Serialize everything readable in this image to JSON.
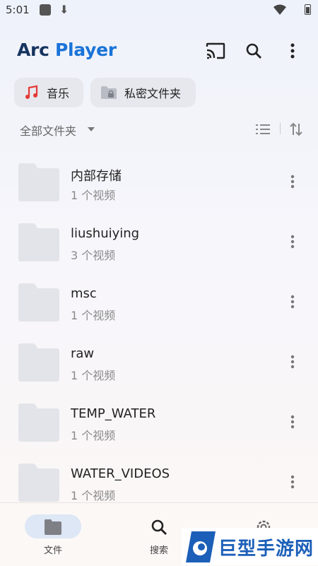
{
  "status_bar": {
    "time": "5:01"
  },
  "header": {
    "logo_part1": "Arc",
    "logo_part2": " Player"
  },
  "chips": {
    "music": "音乐",
    "private": "私密文件夹"
  },
  "filter": {
    "label": "全部文件夹"
  },
  "folders": [
    {
      "name": "内部存储",
      "count": "1 个视频"
    },
    {
      "name": "liushuiying",
      "count": "3 个视频"
    },
    {
      "name": "msc",
      "count": "1 个视频"
    },
    {
      "name": "raw",
      "count": "1 个视频"
    },
    {
      "name": "TEMP_WATER",
      "count": "1 个视频"
    },
    {
      "name": "WATER_VIDEOS",
      "count": "1 个视频"
    }
  ],
  "bottom_nav": {
    "files": "文件",
    "search": "搜索"
  },
  "watermark": {
    "text": "巨型手游网"
  },
  "colors": {
    "brand_blue": "#1a73d8",
    "brand_dark": "#17345f",
    "music_red": "#e53935",
    "nav_active_bg": "#dde7f5"
  }
}
